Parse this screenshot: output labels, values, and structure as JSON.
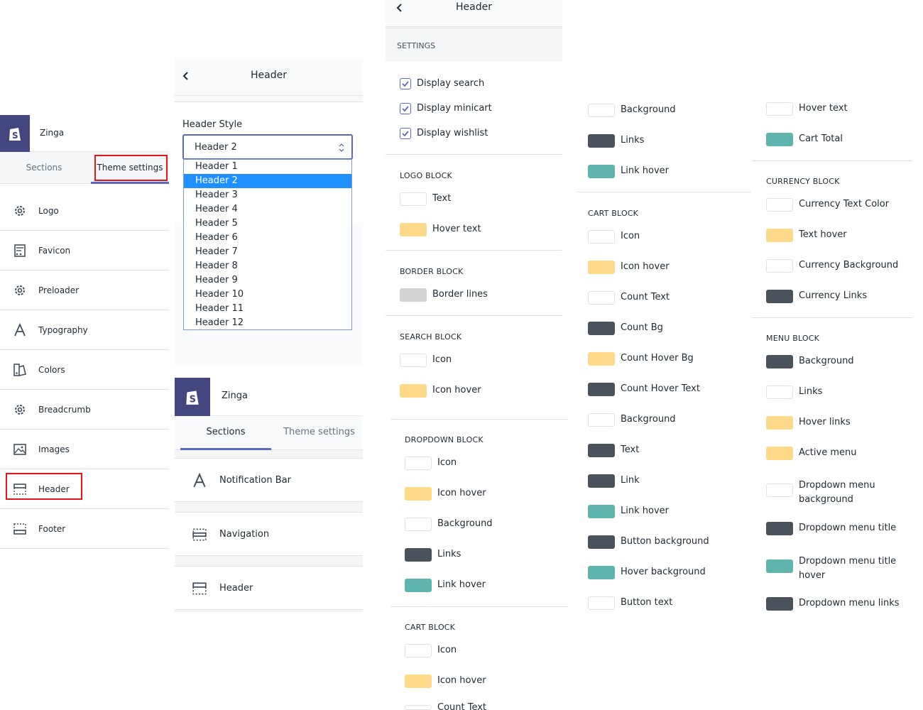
{
  "colors": {
    "white": "#ffffff",
    "yellow": "#ffd98a",
    "dark": "#4a525c",
    "teal": "#5fb4ad",
    "grey": "#d3d3d3",
    "brand": "#43467f",
    "accent": "#5c6ac4",
    "highlight": "#e5141b"
  },
  "panel1": {
    "store_name": "Zinga",
    "tabs": [
      "Sections",
      "Theme settings"
    ],
    "items": [
      {
        "label": "Logo",
        "icon": "gear-icon"
      },
      {
        "label": "Favicon",
        "icon": "favicon-icon"
      },
      {
        "label": "Preloader",
        "icon": "gear-icon"
      },
      {
        "label": "Typography",
        "icon": "typography-icon"
      },
      {
        "label": "Colors",
        "icon": "colors-icon"
      },
      {
        "label": "Breadcrumb",
        "icon": "gear-icon"
      },
      {
        "label": "Images",
        "icon": "image-icon"
      },
      {
        "label": "Header",
        "icon": "header-layout-icon"
      },
      {
        "label": "Footer",
        "icon": "footer-layout-icon"
      }
    ]
  },
  "panel2": {
    "title": "Header",
    "field_label": "Header Style",
    "selected": "Header 2",
    "options": [
      "Header 1",
      "Header 2",
      "Header 3",
      "Header 4",
      "Header 5",
      "Header 6",
      "Header 7",
      "Header 8",
      "Header 9",
      "Header 10",
      "Header 11",
      "Header 12"
    ]
  },
  "panel3": {
    "store_name": "Zinga",
    "tabs": [
      "Sections",
      "Theme settings"
    ],
    "sections": [
      "Notification Bar",
      "Navigation",
      "Header"
    ]
  },
  "panel4": {
    "title": "Header",
    "settings_label": "SETTINGS",
    "checkboxes": [
      "Display search",
      "Display minicart",
      "Display wishlist"
    ],
    "blocks": {
      "logo": {
        "title": "LOGO BLOCK",
        "items": [
          "Text",
          "Hover text"
        ]
      },
      "border": {
        "title": "BORDER BLOCK",
        "items": [
          "Border lines"
        ]
      },
      "search": {
        "title": "SEARCH BLOCK",
        "items": [
          "Icon",
          "Icon hover"
        ]
      },
      "dropdown": {
        "title": "DROPDOWN BLOCK",
        "items": [
          "Icon",
          "Icon hover",
          "Background",
          "Links",
          "Link hover"
        ]
      },
      "cart": {
        "title": "CART BLOCK",
        "items": [
          "Icon",
          "Icon hover",
          "Count Text"
        ]
      }
    }
  },
  "panel5": {
    "top_items": [
      "Background",
      "Links",
      "Link hover"
    ],
    "cart_title": "CART BLOCK",
    "cart_items": [
      "Icon",
      "Icon hover",
      "Count Text",
      "Count Bg",
      "Count Hover Bg",
      "Count Hover Text",
      "Background",
      "Text",
      "Link",
      "Link hover",
      "Button background",
      "Hover background",
      "Button text"
    ]
  },
  "panel6": {
    "top_items": [
      "Hover text",
      "Cart Total"
    ],
    "currency_title": "CURRENCY BLOCK",
    "currency_items": [
      "Currency Text Color",
      "Text hover",
      "Currency Background",
      "Currency Links"
    ],
    "menu_title": "MENU BLOCK",
    "menu_items": [
      "Background",
      "Links",
      "Hover links",
      "Active menu",
      "Dropdown menu background",
      "Dropdown menu title",
      "Dropdown menu title hover",
      "Dropdown menu links"
    ]
  }
}
